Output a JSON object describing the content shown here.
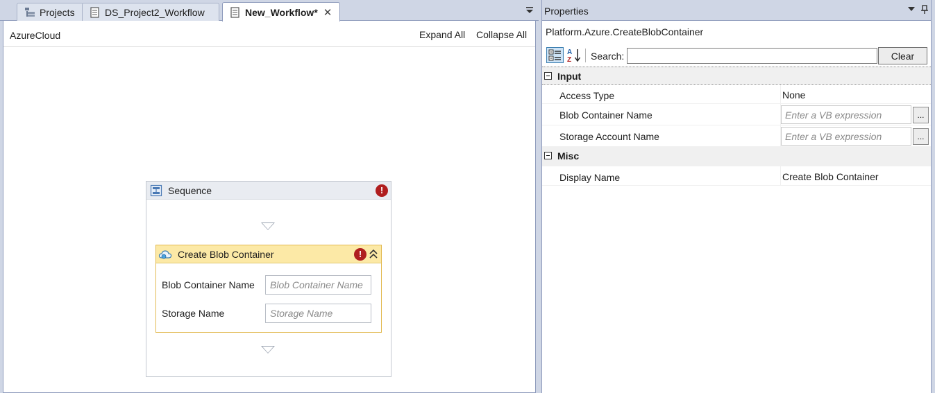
{
  "tabs": [
    {
      "label": "Projects",
      "icon": "project-explorer-icon",
      "active": false
    },
    {
      "label": "DS_Project2_Workflow",
      "icon": "document-icon",
      "active": false
    },
    {
      "label": "New_Workflow*",
      "icon": "document-icon",
      "active": true,
      "close": "✕"
    }
  ],
  "designer": {
    "breadcrumb": "AzureCloud",
    "expand_all": "Expand All",
    "collapse_all": "Collapse All",
    "sequence": {
      "title": "Sequence",
      "error_glyph": "!",
      "activity": {
        "title": "Create Blob Container",
        "error_glyph": "!",
        "fields": [
          {
            "label": "Blob Container Name",
            "placeholder": "Blob Container Name"
          },
          {
            "label": "Storage Name",
            "placeholder": "Storage Name"
          }
        ]
      }
    }
  },
  "properties": {
    "title": "Properties",
    "object": "Platform.Azure.CreateBlobContainer",
    "search_label": "Search:",
    "search_value": "",
    "clear_label": "Clear",
    "categories": [
      {
        "name": "Input",
        "rows": [
          {
            "name": "Access Type",
            "value": "None"
          },
          {
            "name": "Blob Container Name",
            "placeholder": "Enter a VB expression",
            "button": "..."
          },
          {
            "name": "Storage Account Name",
            "placeholder": "Enter a VB expression",
            "button": "..."
          }
        ]
      },
      {
        "name": "Misc",
        "rows": [
          {
            "name": "Display Name",
            "value": "Create Blob Container"
          }
        ]
      }
    ]
  },
  "colors": {
    "accent": "#3c7fb1",
    "activity_header": "#fce9a6",
    "activity_border": "#e2b94f",
    "error": "#b01e1e",
    "chrome": "#cfd6e5"
  }
}
